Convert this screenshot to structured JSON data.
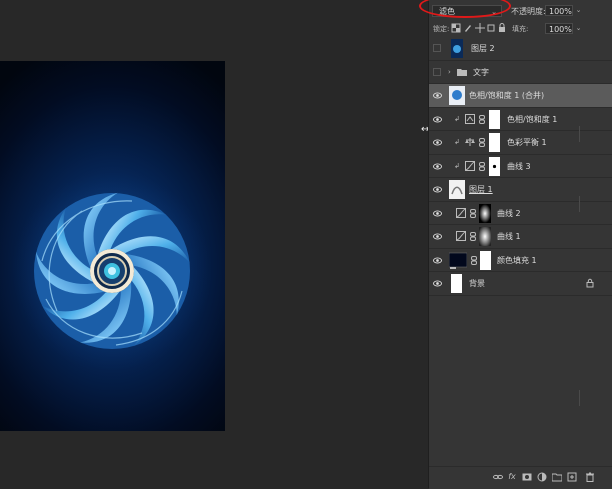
{
  "blend_mode": {
    "value": "滤色"
  },
  "opacity": {
    "label": "不透明度:",
    "value": "100%"
  },
  "lock": {
    "label": "锁定:"
  },
  "fill": {
    "label": "填充:",
    "value": "100%"
  },
  "layers": [
    {
      "name": "图层 2",
      "kind": "pixel-thumb-blue",
      "visible": false
    },
    {
      "name": "文字",
      "kind": "group",
      "visible": false
    },
    {
      "name": "色相/饱和度 1 (合并)",
      "kind": "merged",
      "visible": true,
      "selected": true
    },
    {
      "name": "色相/饱和度 1",
      "kind": "hue-saturation",
      "visible": true,
      "clipped": true
    },
    {
      "name": "色彩平衡 1",
      "kind": "color-balance",
      "visible": true,
      "clipped": true
    },
    {
      "name": "曲线 3",
      "kind": "curves-dotmask",
      "visible": true,
      "clipped": true
    },
    {
      "name": "图层 1",
      "kind": "pixel-thumb-white",
      "visible": true
    },
    {
      "name": "曲线 2",
      "kind": "curves-radialmask",
      "visible": true
    },
    {
      "name": "曲线 1",
      "kind": "curves-radialmask",
      "visible": true
    },
    {
      "name": "颜色填充 1",
      "kind": "solid-fill",
      "visible": true
    },
    {
      "name": "背景",
      "kind": "background",
      "visible": true,
      "locked": true
    }
  ],
  "bottom_icons": [
    "link-layers-icon",
    "fx-icon",
    "add-mask-icon",
    "adjustment-icon",
    "group-icon",
    "new-layer-icon",
    "trash-icon"
  ],
  "colors": {
    "panel": "#353535",
    "canvas_bg": "#282828",
    "selected_row": "#5b5b5b",
    "annotation_oval": "#e01919",
    "doc_bg": "#05214e"
  }
}
